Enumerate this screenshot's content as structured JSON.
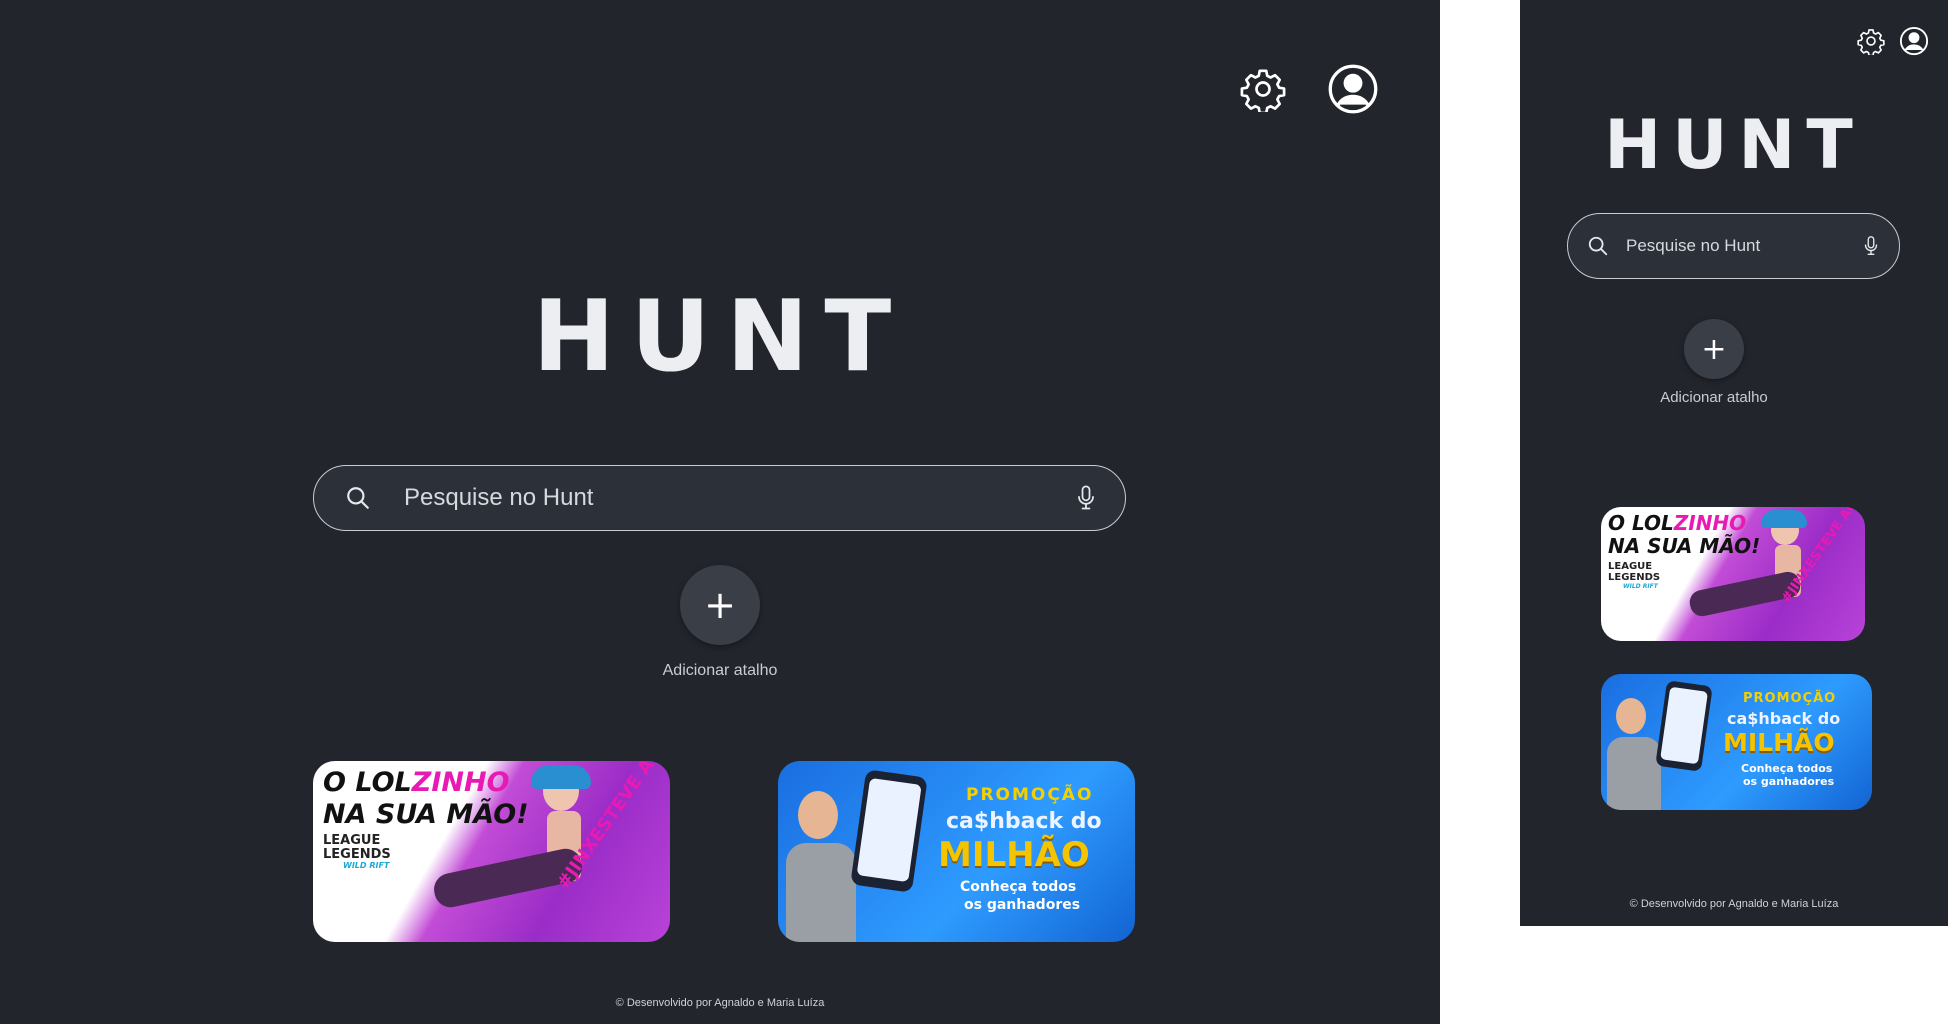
{
  "app": {
    "logo": "HUNT"
  },
  "search": {
    "placeholder": "Pesquise no Hunt"
  },
  "shortcut": {
    "plus": "+",
    "label": "Adicionar atalho"
  },
  "banners": {
    "lol": {
      "line1a": "O LOL",
      "line1b": "ZINHO",
      "line2": "NA SUA MÃO!",
      "brand1": "LEAGUE",
      "brand2": "LEGENDS",
      "brand3": "WILD RIFT",
      "tag": "#JINXESTEVE AQUI!"
    },
    "promo": {
      "promo": "PROMOÇÃO",
      "cashback": "ca$hback do",
      "milhao": "MILHÃO",
      "sub1": "Conheça todos",
      "sub2": "os ganhadores"
    }
  },
  "footer": {
    "text": "© Desenvolvido por Agnaldo e Maria Luíza"
  },
  "icons": {
    "settings": "gear-icon",
    "account": "user-circle-icon",
    "search": "search-icon",
    "mic": "mic-icon"
  },
  "colors": {
    "background": "#22252c",
    "accent_pink": "#e81ab4",
    "promo_blue": "#1a6ee0",
    "promo_yellow": "#f5d000"
  }
}
